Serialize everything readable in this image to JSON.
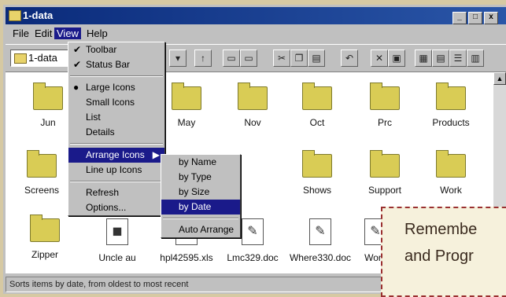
{
  "window": {
    "title": "1-data",
    "controls": [
      "_",
      "□",
      "x"
    ]
  },
  "menubar": [
    "File",
    "Edit",
    "View",
    "Help"
  ],
  "toolbar": {
    "address": "1-data"
  },
  "icons": [
    {
      "label": "Jun",
      "type": "folder"
    },
    {
      "label": "May",
      "type": "folder"
    },
    {
      "label": "Nov",
      "type": "folder"
    },
    {
      "label": "Oct",
      "type": "folder"
    },
    {
      "label": "Prc",
      "type": "folder"
    },
    {
      "label": "Products",
      "type": "folder"
    },
    {
      "label": "Screens",
      "type": "folder"
    },
    {
      "label": "Shows",
      "type": "folder"
    },
    {
      "label": "Support",
      "type": "folder"
    },
    {
      "label": "Work",
      "type": "folder"
    },
    {
      "label": "Zipper",
      "type": "folder"
    },
    {
      "label": "Uncle au",
      "type": "file"
    },
    {
      "label": "hpl42595.xls",
      "type": "xls"
    },
    {
      "label": "Lmc329.doc",
      "type": "doc"
    },
    {
      "label": "Where330.doc",
      "type": "doc"
    },
    {
      "label": "Wom",
      "type": "doc"
    }
  ],
  "view_menu": {
    "items": [
      {
        "label": "Toolbar",
        "mark": "✔"
      },
      {
        "label": "Status Bar",
        "mark": "✔"
      },
      {
        "label": "Large Icons",
        "mark": "●"
      },
      {
        "label": "Small Icons",
        "mark": ""
      },
      {
        "label": "List",
        "mark": ""
      },
      {
        "label": "Details",
        "mark": ""
      },
      {
        "label": "Arrange Icons",
        "mark": "",
        "submenu": "▶"
      },
      {
        "label": "Line up Icons",
        "mark": ""
      },
      {
        "label": "Refresh",
        "mark": ""
      },
      {
        "label": "Options...",
        "mark": ""
      }
    ]
  },
  "arrange_submenu": {
    "items": [
      "by Name",
      "by Type",
      "by Size",
      "by Date",
      "Auto Arrange"
    ]
  },
  "status_text": "Sorts items by date, from oldest to most recent",
  "note": {
    "line1": "Remembe",
    "line2": "and Progr"
  }
}
